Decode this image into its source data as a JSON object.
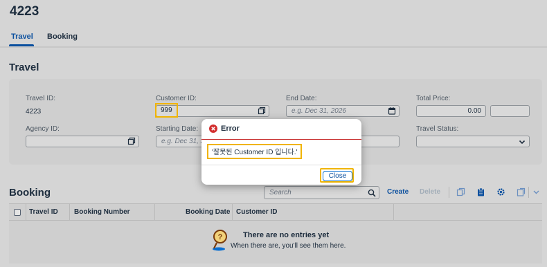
{
  "header": {
    "title": "4223",
    "tabs": [
      {
        "label": "Travel"
      },
      {
        "label": "Booking"
      }
    ]
  },
  "travel": {
    "title": "Travel",
    "travel_id": {
      "label": "Travel ID:",
      "value": "4223"
    },
    "customer_id": {
      "label": "Customer ID:",
      "value": "999"
    },
    "end_date": {
      "label": "End Date:",
      "placeholder": "e.g. Dec 31, 2026"
    },
    "total_price": {
      "label": "Total Price:",
      "value": "0.00",
      "currency": ""
    },
    "agency_id": {
      "label": "Agency ID:",
      "value": ""
    },
    "starting_date": {
      "label": "Starting Date:",
      "placeholder": "e.g. Dec 31, 2"
    },
    "travel_status": {
      "label": "Travel Status:",
      "value": ""
    }
  },
  "booking": {
    "title": "Booking",
    "search_placeholder": "Search",
    "toolbar": {
      "create": "Create",
      "delete": "Delete"
    },
    "columns": [
      "Travel ID",
      "Booking Number",
      "Booking Date",
      "Customer ID"
    ],
    "empty": {
      "title": "There are no entries yet",
      "subtitle": "When there are, you'll see them here."
    }
  },
  "dialog": {
    "title": "Error",
    "message": "'잘못된 Customer ID 입니다.'",
    "close_label": "Close"
  },
  "colors": {
    "accent": "#0a4f9e",
    "error": "#c72b2b",
    "highlight": "#f0b400"
  },
  "icons": [
    "value-help-icon",
    "calendar-icon",
    "chevron-down-icon",
    "search-icon",
    "copy-icon",
    "paste-icon",
    "settings-icon",
    "export-icon",
    "error-icon",
    "empty-state-icon"
  ]
}
